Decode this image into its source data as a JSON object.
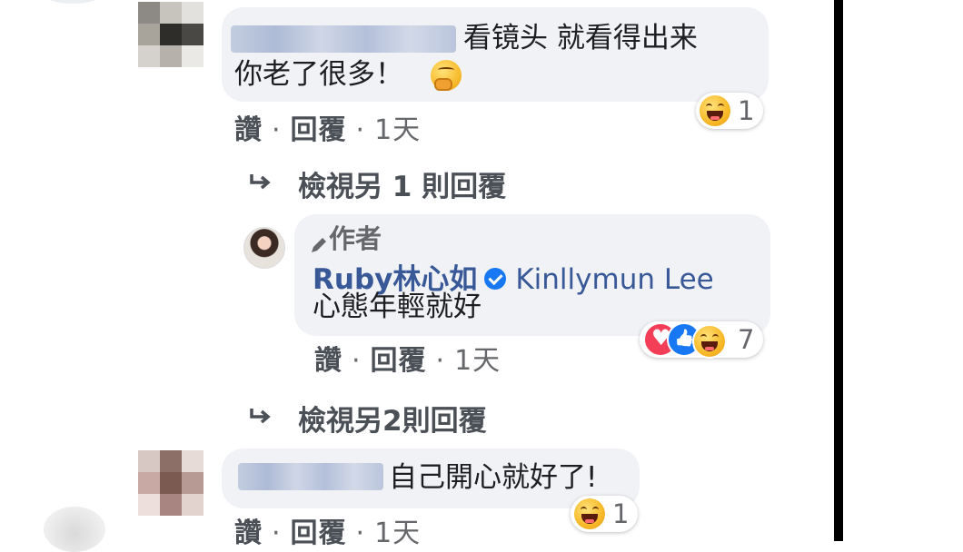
{
  "comment1": {
    "text_line1": "看镜头 就看得出来",
    "text_line2": "你老了很多！",
    "reaction_count": "1"
  },
  "meta1": {
    "like": "讚",
    "reply": "回覆",
    "time": "1天"
  },
  "view_more1": "檢視另 1 則回覆",
  "reply": {
    "author_badge": "作者",
    "name": "Ruby林心如",
    "tagged": "Kinllymun Lee",
    "text": "心態年輕就好",
    "reaction_count": "7"
  },
  "meta2": {
    "like": "讚",
    "reply": "回覆",
    "time": "1天"
  },
  "view_more2": "檢視另2則回覆",
  "comment2": {
    "text": "自己開心就好了!",
    "reaction_count": "1"
  },
  "meta3": {
    "like": "讚",
    "reply": "回覆",
    "time": "1天"
  },
  "colors": {
    "link": "#385898",
    "bubble": "#f0f2f5",
    "meta": "#4b4f56",
    "verified": "#1877f2",
    "love": "#f33e58"
  }
}
